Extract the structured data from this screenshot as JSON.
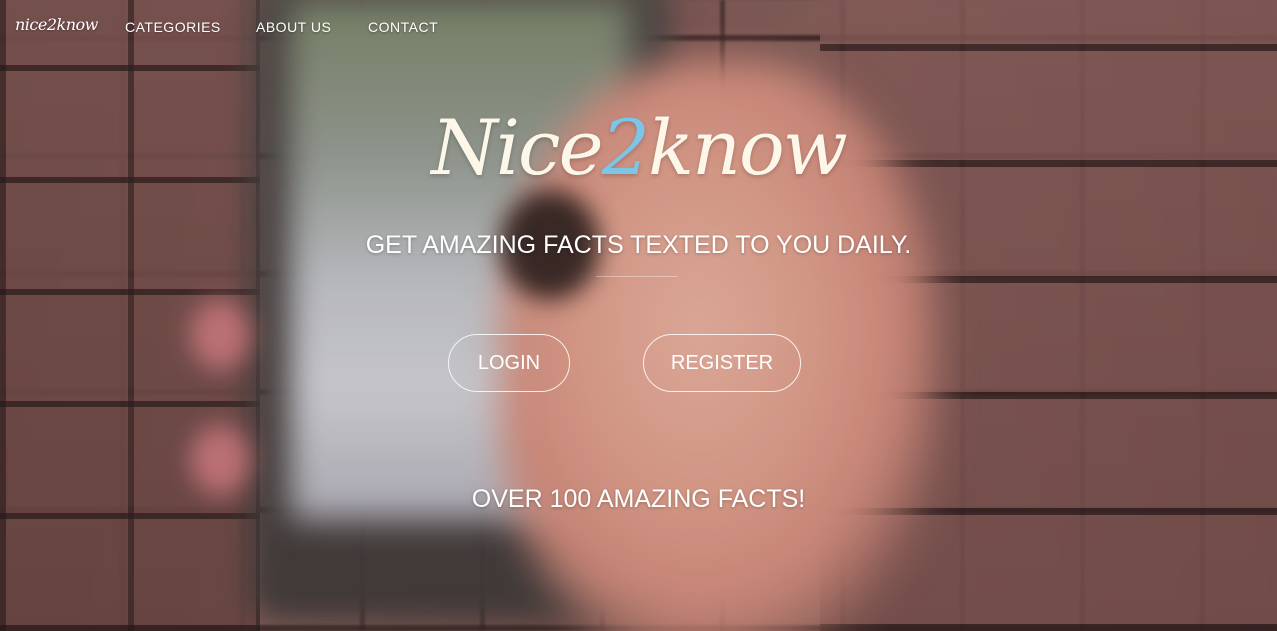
{
  "nav": {
    "brand": "nice2know",
    "links": [
      {
        "label": "CATEGORIES"
      },
      {
        "label": "ABOUT US"
      },
      {
        "label": "CONTACT"
      }
    ]
  },
  "hero": {
    "logo_prefix": "Nice",
    "logo_accent": "2",
    "logo_suffix": "know",
    "tagline": "GET AMAZING FACTS TEXTED TO YOU DAILY.",
    "login_label": "LOGIN",
    "register_label": "REGISTER",
    "facts_text": "OVER 100 AMAZING FACTS!"
  },
  "colors": {
    "accent": "#7cc4e8",
    "logo_text": "#fdf7ea",
    "text": "#ffffff"
  }
}
